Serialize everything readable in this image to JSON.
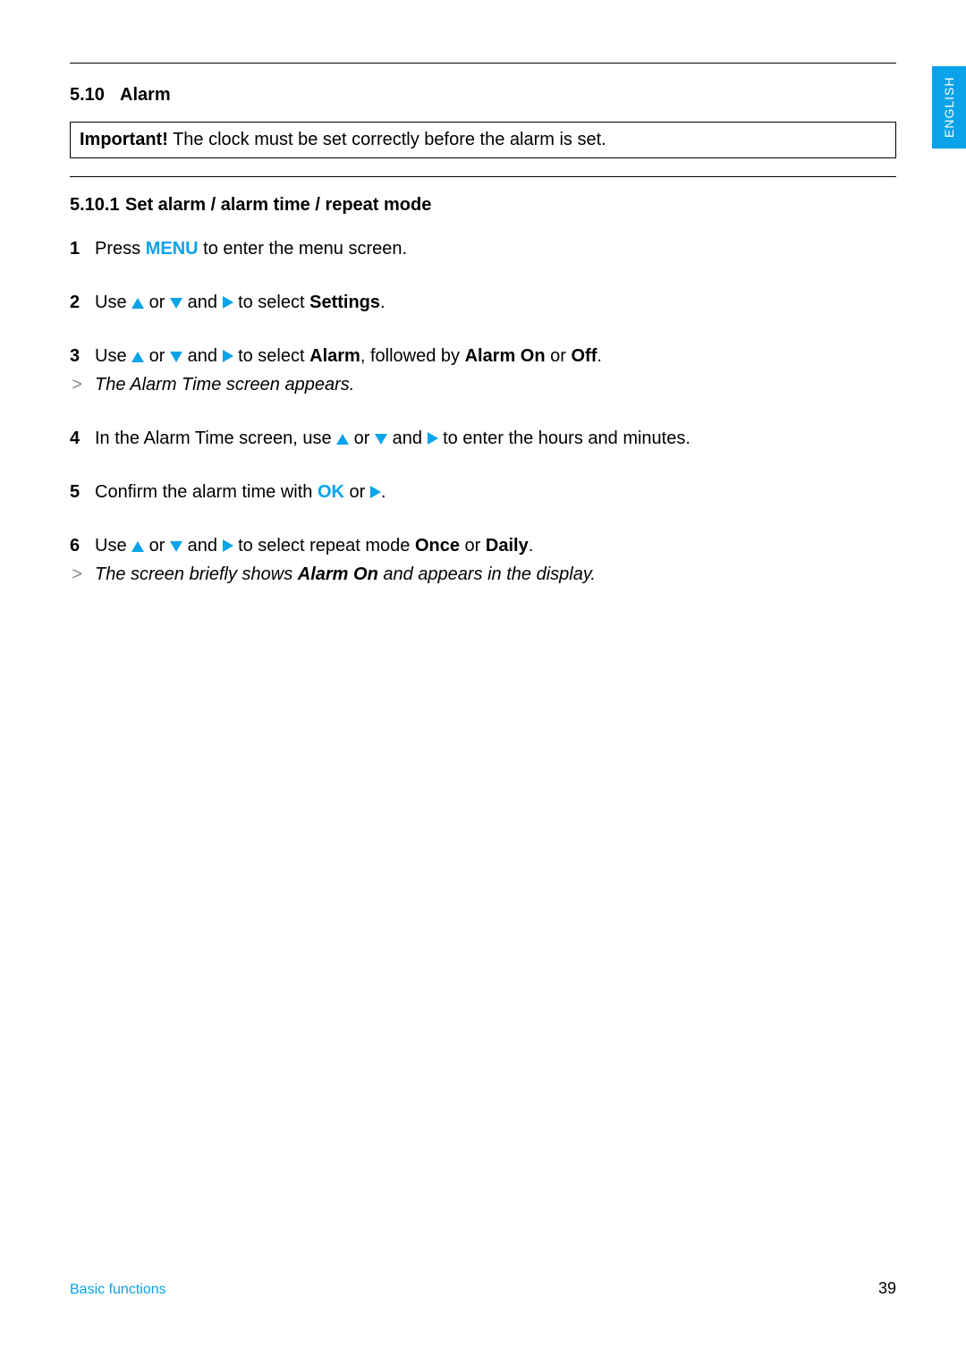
{
  "lang_tab": "ENGLISH",
  "section": {
    "number": "5.10",
    "title": "Alarm"
  },
  "important": {
    "label": "Important!",
    "text": " The clock must be set correctly before the alarm is set."
  },
  "subsection": {
    "number": "5.10.1",
    "title": "Set alarm / alarm time / repeat mode"
  },
  "steps": {
    "s1": {
      "num": "1",
      "a": "Press ",
      "menu": "MENU",
      "b": " to enter the menu screen."
    },
    "s2": {
      "num": "2",
      "a": "Use ",
      "b": " or ",
      "c": " and ",
      "d": " to select ",
      "settings": "Settings",
      "e": "."
    },
    "s3": {
      "num": "3",
      "a": "Use ",
      "b": " or ",
      "c": " and ",
      "d": " to select ",
      "alarm": "Alarm",
      "e": ", followed by ",
      "on": "Alarm On",
      "f": " or ",
      "off": "Off",
      "g": "."
    },
    "r3": {
      "text": "The Alarm Time screen appears."
    },
    "s4": {
      "num": "4",
      "a": "In the Alarm Time screen, use ",
      "b": " or ",
      "c": " and ",
      "d": " to enter the hours and minutes."
    },
    "s5": {
      "num": "5",
      "a": "Confirm the alarm time with ",
      "ok": "OK",
      "b": " or ",
      "c": "."
    },
    "s6": {
      "num": "6",
      "a": "Use ",
      "b": " or ",
      "c": " and ",
      "d": " to select repeat mode ",
      "once": "Once",
      "e": " or ",
      "daily": "Daily",
      "f": "."
    },
    "r6": {
      "a": "The screen briefly shows ",
      "b": "Alarm On",
      "c": " and      appears in the display."
    }
  },
  "footer": {
    "left": "Basic functions",
    "right": "39"
  },
  "colors": {
    "accent": "#0aa3ea"
  }
}
